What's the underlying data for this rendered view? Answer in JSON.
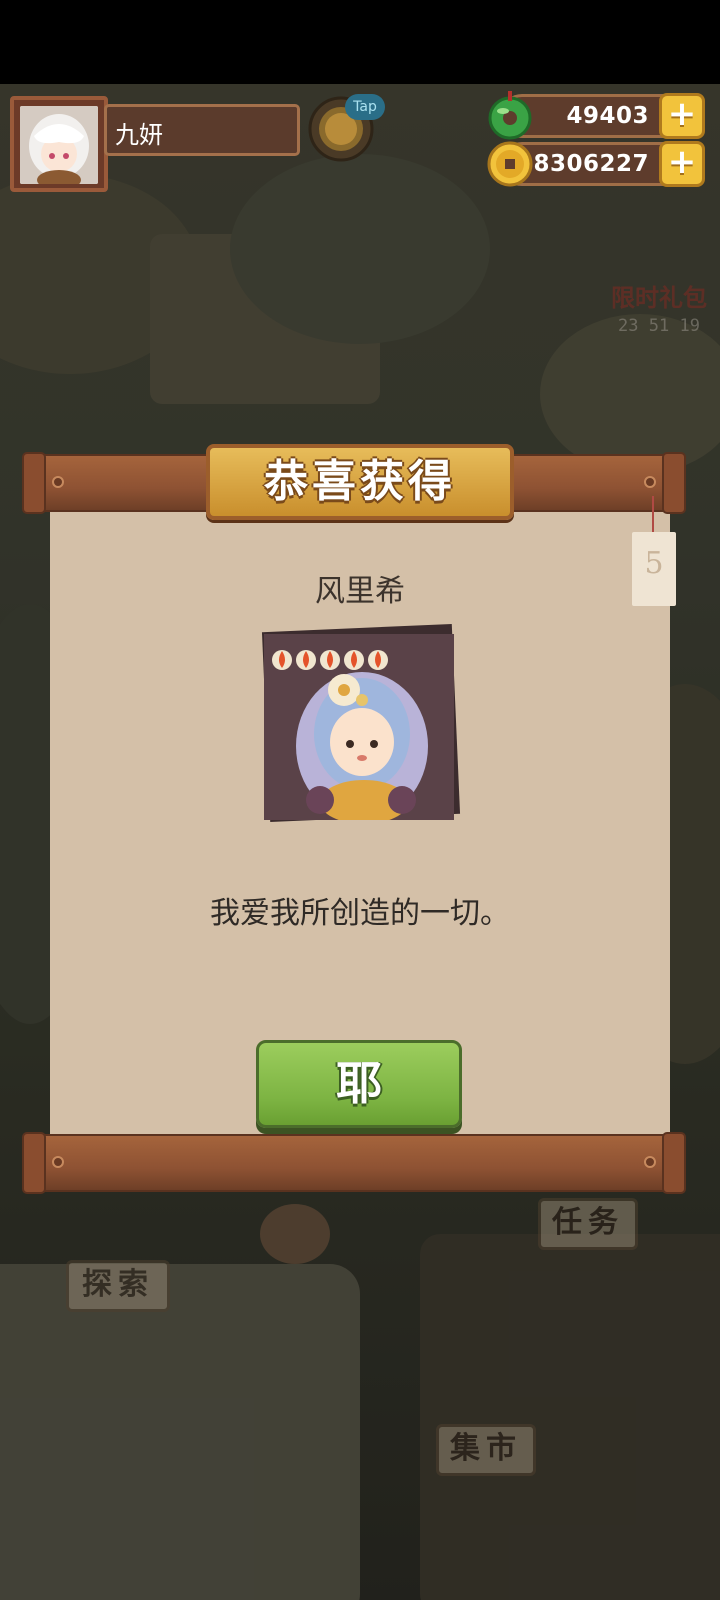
{
  "player": {
    "name": "九妍"
  },
  "tap_hint": "Tap",
  "resources": {
    "jade": {
      "value": "49403",
      "plus": "+",
      "icon": "jade-coin-icon",
      "color": "#3aa345"
    },
    "coins": {
      "value": "8306227",
      "plus": "+",
      "icon": "gold-coin-icon",
      "color": "#f2c33c"
    }
  },
  "background": {
    "limited_pack": {
      "label": "限时礼包",
      "timer": "23 51 19"
    },
    "buttons": {
      "task": "任务",
      "explore": "探索",
      "market": "集市"
    }
  },
  "modal": {
    "title": "恭喜获得",
    "tag_number": "5",
    "character_name": "风里希",
    "rarity_flames": 5,
    "quote": "我爱我所创造的一切。",
    "confirm_label": "耶",
    "accent": "#7cb342"
  }
}
